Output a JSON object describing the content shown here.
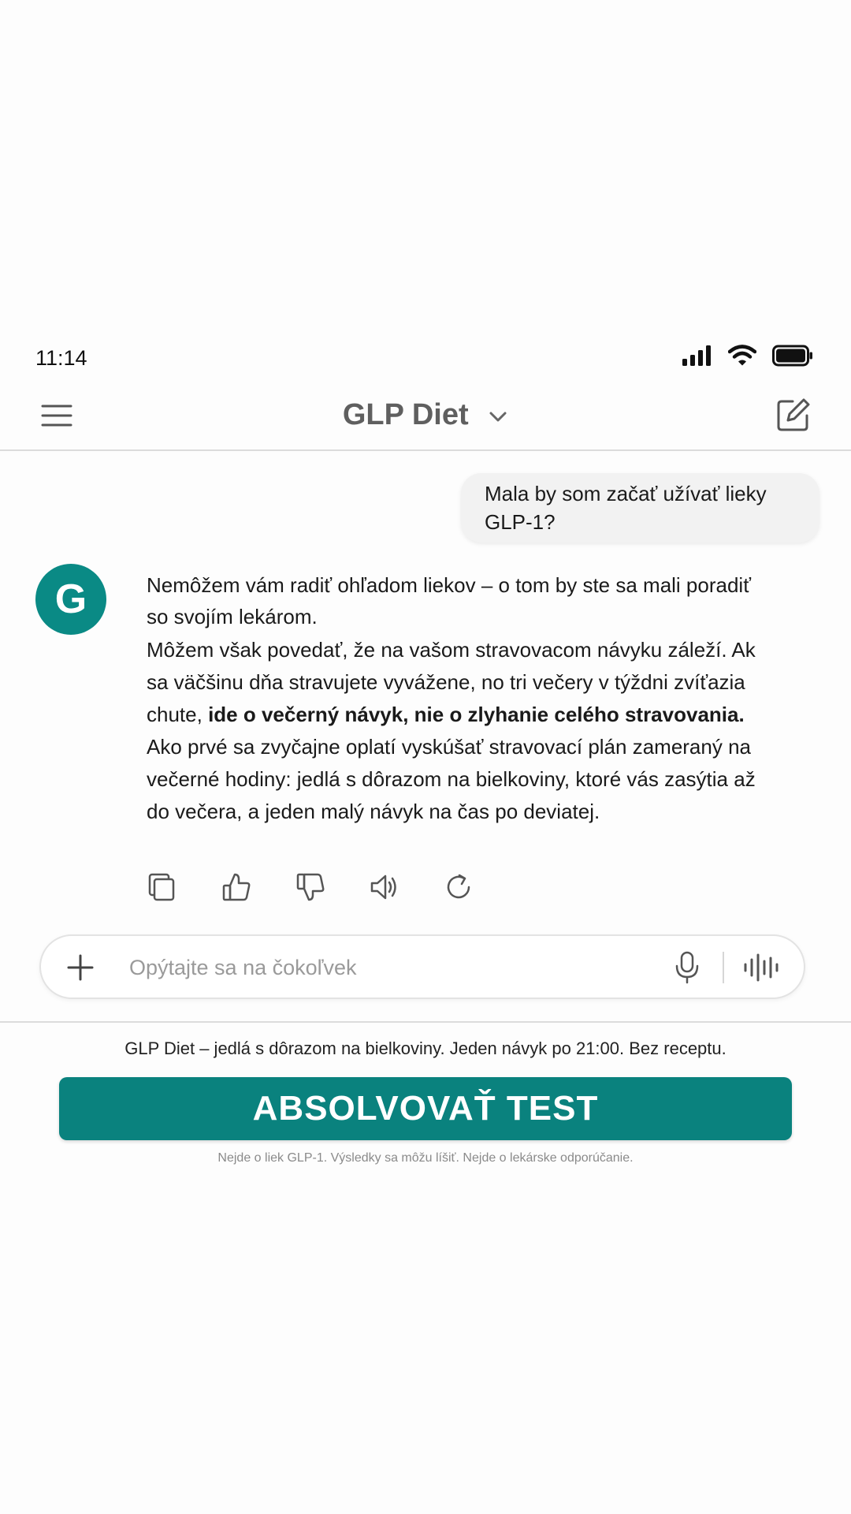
{
  "status_bar": {
    "time": "11:14"
  },
  "header": {
    "title": "GLP Diet"
  },
  "conversation": {
    "user_message": "Mala by som začať užívať lieky GLP-1?",
    "assistant_avatar": "G",
    "assistant_message": {
      "paragraph_1": "Nemôžem vám radiť ohľadom liekov – o tom by ste sa mali poradiť so svojím lekárom.",
      "paragraph_2_plain": "Môžem však povedať, že na vašom stravovacom návyku záleží. Ak sa väčšinu dňa stravujete vyvážene, no tri večery v týždni zvíťazia chute,",
      "paragraph_2_bold": "ide o večerný návyk, nie o zlyhanie celého stravovania.",
      "paragraph_3": "Ako prvé sa zvyčajne oplatí vyskúšať stravovací plán zameraný na večerné hodiny: jedlá s dôrazom na bielkoviny, ktoré vás zasýtia až do večera, a jeden malý návyk na čas po deviatej."
    }
  },
  "composer": {
    "placeholder": "Opýtajte sa na čokoľvek"
  },
  "promo": {
    "text": "GLP Diet – jedlá s dôrazom na bielkoviny. Jeden návyk po 21:00. Bez receptu.",
    "cta_label": "ABSOLVOVAŤ TEST",
    "disclaimer": "Nejde o liek GLP-1. Výsledky sa môžu líšiť. Nejde o lekárske odporúčanie."
  },
  "colors": {
    "accent": "#0a827e",
    "avatar": "#0a8a85",
    "header_title": "#5f5f5f"
  },
  "icons": [
    "signal-icon",
    "wifi-icon",
    "battery-icon",
    "menu-icon",
    "chevron-down-icon",
    "new-chat-icon",
    "copy-icon",
    "thumbs-up-icon",
    "thumbs-down-icon",
    "speaker-icon",
    "regenerate-icon",
    "plus-icon",
    "microphone-icon",
    "voice-wave-icon"
  ]
}
